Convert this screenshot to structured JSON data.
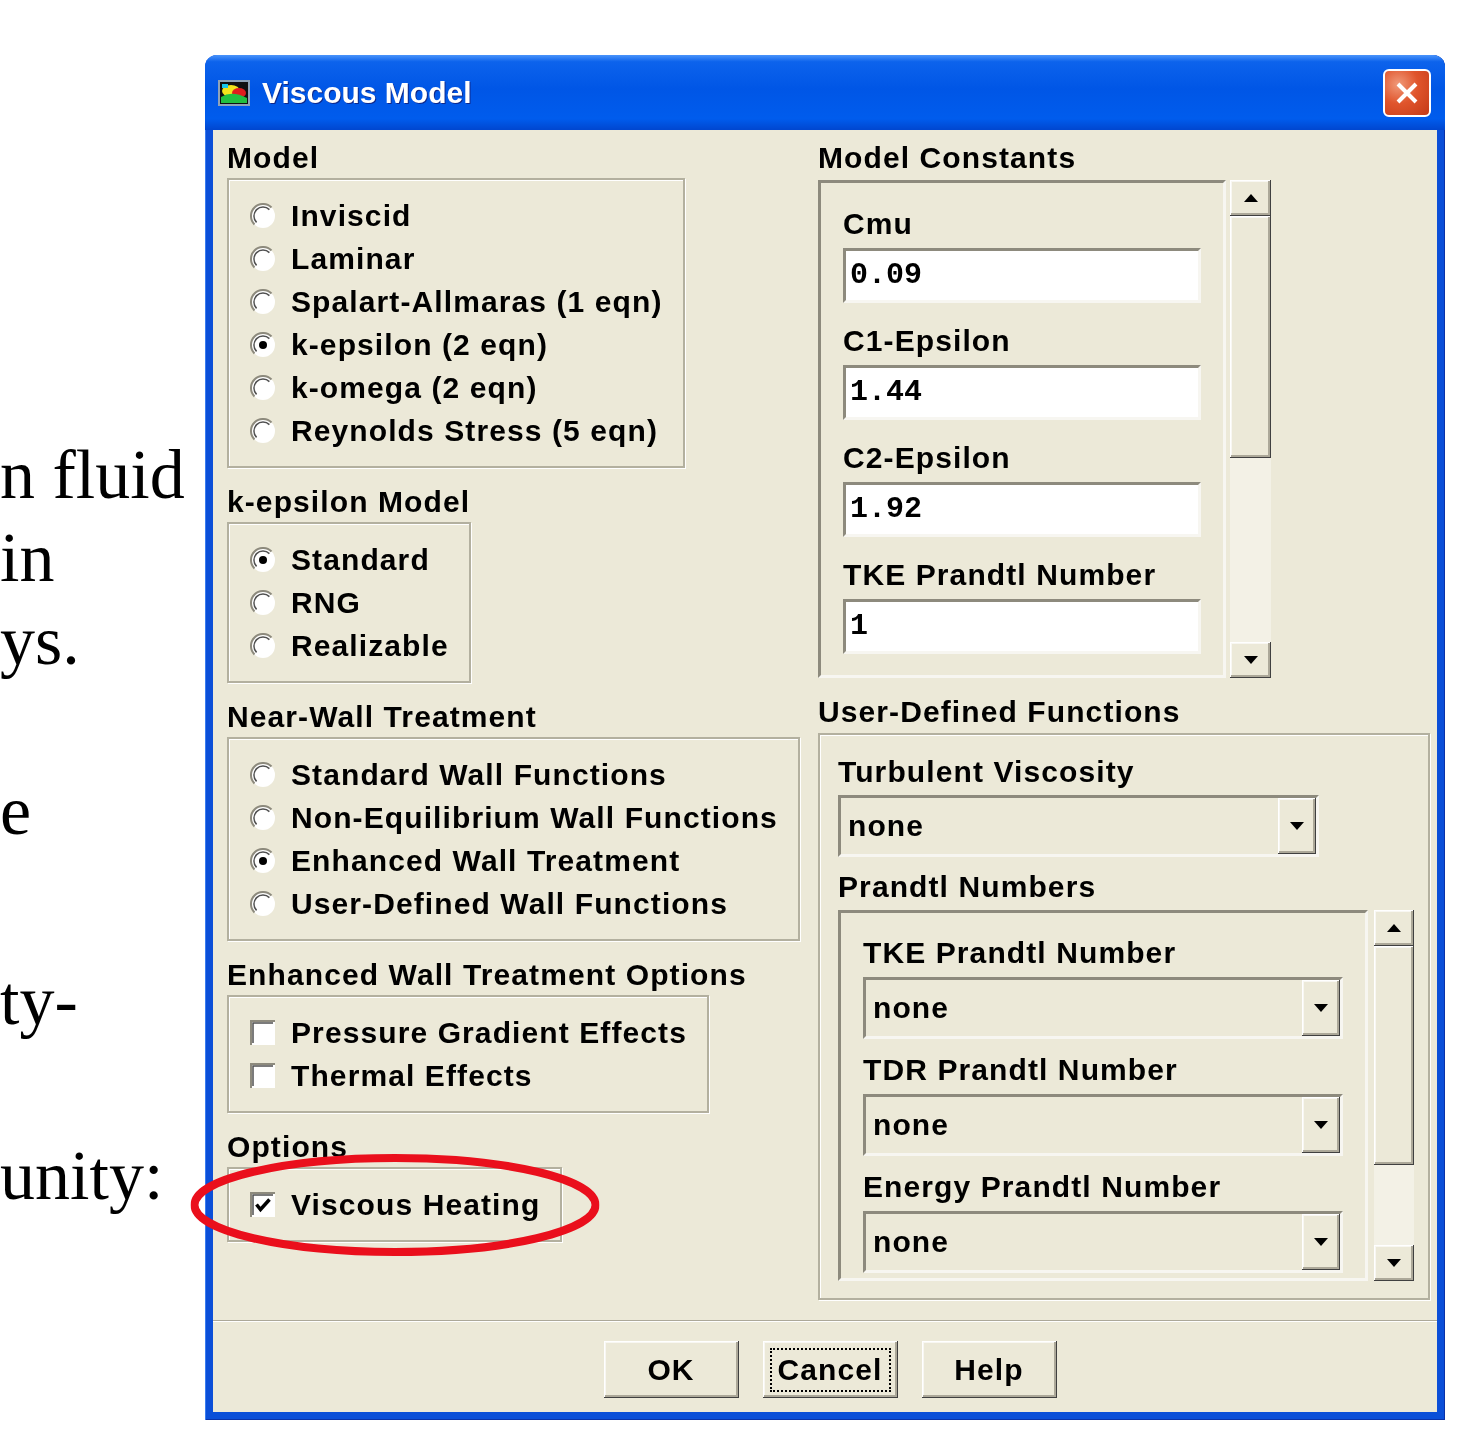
{
  "slide_text": [
    "n fluid",
    "in",
    "ys.",
    "e",
    "ty-",
    "unity:"
  ],
  "window": {
    "title": "Viscous Model"
  },
  "model": {
    "label": "Model",
    "kind": "radio",
    "items": [
      {
        "label": "Inviscid",
        "selected": false
      },
      {
        "label": "Laminar",
        "selected": false
      },
      {
        "label": "Spalart-Allmaras (1 eqn)",
        "selected": false
      },
      {
        "label": "k-epsilon (2 eqn)",
        "selected": true
      },
      {
        "label": "k-omega (2 eqn)",
        "selected": false
      },
      {
        "label": "Reynolds Stress (5 eqn)",
        "selected": false
      }
    ]
  },
  "k_epsilon_model": {
    "label": "k-epsilon Model",
    "kind": "radio",
    "items": [
      {
        "label": "Standard",
        "selected": true
      },
      {
        "label": "RNG",
        "selected": false
      },
      {
        "label": "Realizable",
        "selected": false
      }
    ]
  },
  "near_wall_treatment": {
    "label": "Near-Wall Treatment",
    "kind": "radio",
    "items": [
      {
        "label": "Standard Wall Functions",
        "selected": false
      },
      {
        "label": "Non-Equilibrium Wall Functions",
        "selected": false
      },
      {
        "label": "Enhanced Wall Treatment",
        "selected": true
      },
      {
        "label": "User-Defined Wall Functions",
        "selected": false
      }
    ]
  },
  "enhanced_wall_treatment_options": {
    "label": "Enhanced Wall Treatment Options",
    "kind": "checkbox",
    "items": [
      {
        "label": "Pressure Gradient Effects",
        "checked": false
      },
      {
        "label": "Thermal Effects",
        "checked": false
      }
    ]
  },
  "options": {
    "label": "Options",
    "kind": "checkbox",
    "items": [
      {
        "label": "Viscous Heating",
        "checked": true,
        "highlighted": true
      }
    ]
  },
  "model_constants": {
    "label": "Model Constants",
    "fields": [
      {
        "label": "Cmu",
        "value": "0.09"
      },
      {
        "label": "C1-Epsilon",
        "value": "1.44"
      },
      {
        "label": "C2-Epsilon",
        "value": "1.92"
      },
      {
        "label": "TKE Prandtl Number",
        "value": "1"
      }
    ]
  },
  "user_defined_functions": {
    "label": "User-Defined Functions",
    "turbulent_viscosity": {
      "label": "Turbulent Viscosity",
      "value": "none"
    },
    "prandtl_numbers": {
      "label": "Prandtl Numbers",
      "fields": [
        {
          "label": "TKE Prandtl Number",
          "value": "none"
        },
        {
          "label": "TDR Prandtl Number",
          "value": "none"
        },
        {
          "label": "Energy Prandtl Number",
          "value": "none"
        }
      ]
    }
  },
  "buttons": [
    {
      "label": "OK",
      "focused": false
    },
    {
      "label": "Cancel",
      "focused": true
    },
    {
      "label": "Help",
      "focused": false
    }
  ]
}
